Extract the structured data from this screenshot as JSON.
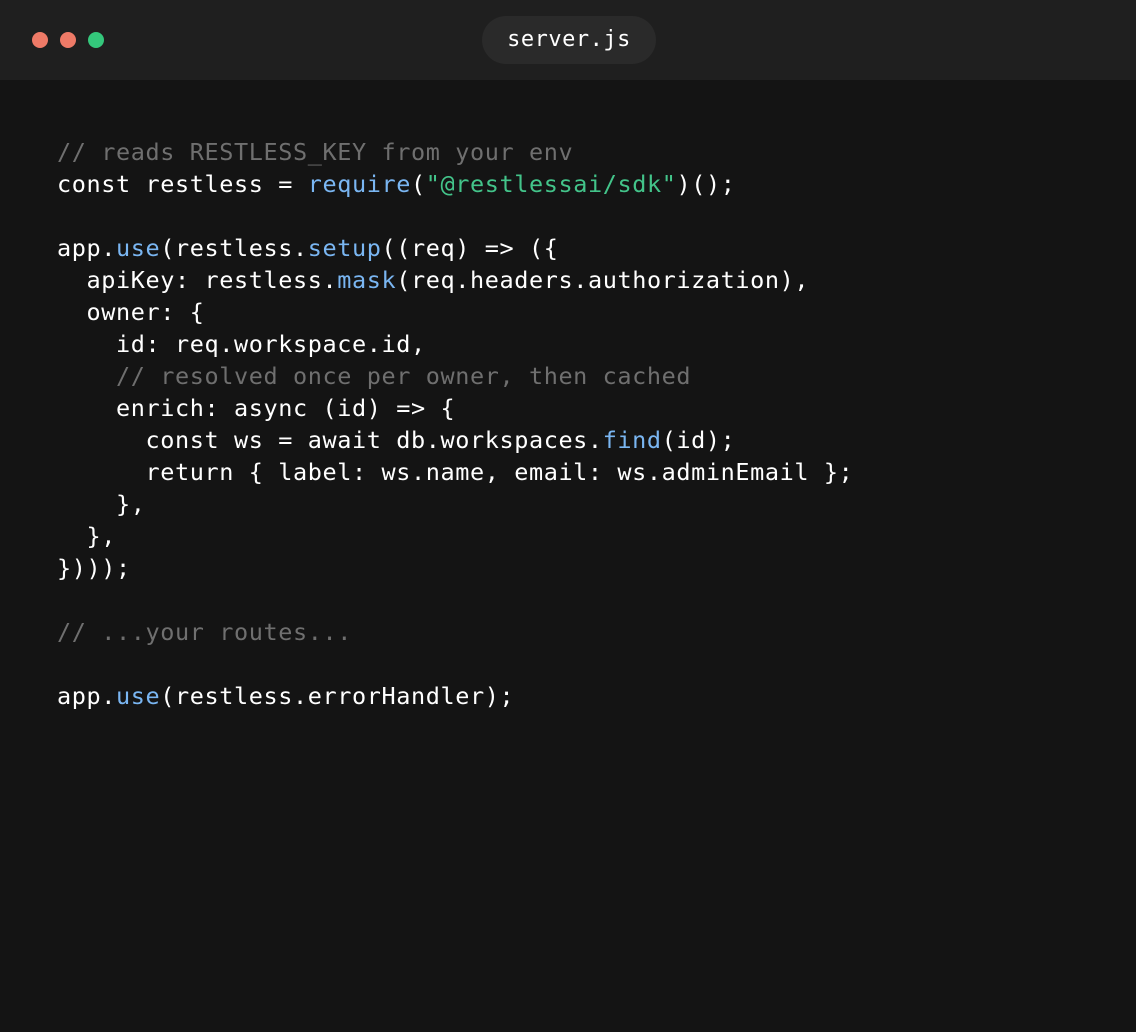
{
  "window": {
    "title": "server.js",
    "traffic_lights": [
      {
        "name": "close-dot",
        "color": "#ee7a67"
      },
      {
        "name": "minimize-dot",
        "color": "#ee7a67"
      },
      {
        "name": "maximize-dot",
        "color": "#34c77b"
      }
    ]
  },
  "colors": {
    "background": "#141414",
    "titlebar": "#1f1f1f",
    "text": "#ffffff",
    "comment": "#6f6f6f",
    "function": "#7ab6f2",
    "string": "#43c48a"
  },
  "code": {
    "language": "javascript",
    "lines": [
      [
        {
          "t": "comment",
          "v": "// reads RESTLESS_KEY from your env"
        }
      ],
      [
        {
          "t": "plain",
          "v": "const restless = "
        },
        {
          "t": "fn",
          "v": "require"
        },
        {
          "t": "plain",
          "v": "("
        },
        {
          "t": "string",
          "v": "\"@restlessai/sdk\""
        },
        {
          "t": "plain",
          "v": ")();"
        }
      ],
      [],
      [
        {
          "t": "plain",
          "v": "app."
        },
        {
          "t": "fn",
          "v": "use"
        },
        {
          "t": "plain",
          "v": "(restless."
        },
        {
          "t": "fn",
          "v": "setup"
        },
        {
          "t": "plain",
          "v": "((req) => ({"
        }
      ],
      [
        {
          "t": "plain",
          "v": "  apiKey: restless."
        },
        {
          "t": "fn",
          "v": "mask"
        },
        {
          "t": "plain",
          "v": "(req.headers.authorization),"
        }
      ],
      [
        {
          "t": "plain",
          "v": "  owner: {"
        }
      ],
      [
        {
          "t": "plain",
          "v": "    id: req.workspace.id,"
        }
      ],
      [
        {
          "t": "comment",
          "v": "    // resolved once per owner, then cached"
        }
      ],
      [
        {
          "t": "plain",
          "v": "    enrich: async (id) => {"
        }
      ],
      [
        {
          "t": "plain",
          "v": "      const ws = await db.workspaces."
        },
        {
          "t": "fn",
          "v": "find"
        },
        {
          "t": "plain",
          "v": "(id);"
        }
      ],
      [
        {
          "t": "plain",
          "v": "      return { label: ws.name, email: ws.adminEmail };"
        }
      ],
      [
        {
          "t": "plain",
          "v": "    },"
        }
      ],
      [
        {
          "t": "plain",
          "v": "  },"
        }
      ],
      [
        {
          "t": "plain",
          "v": "})));"
        }
      ],
      [],
      [
        {
          "t": "comment",
          "v": "// ...your routes..."
        }
      ],
      [],
      [
        {
          "t": "plain",
          "v": "app."
        },
        {
          "t": "fn",
          "v": "use"
        },
        {
          "t": "plain",
          "v": "(restless.errorHandler);"
        }
      ]
    ]
  }
}
